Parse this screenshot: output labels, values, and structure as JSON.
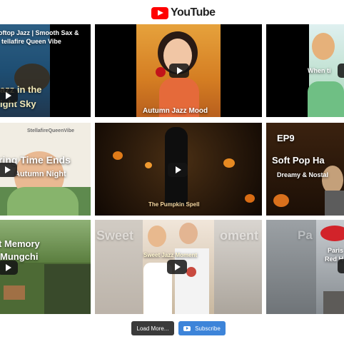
{
  "brand": {
    "logo_text": "YouTube"
  },
  "videos": [
    {
      "line1": "oftop Jazz | Smooth Sax &",
      "line2": "tellafire Queen Vibe",
      "line3": "azz in the",
      "line4": "ight Sky"
    },
    {
      "title": "Autumn Jazz Mood"
    },
    {
      "title": "When ti"
    },
    {
      "watermark": "StellafireQueenVibe",
      "line1": "ring Time Ends",
      "line2": "Autumn Night"
    },
    {
      "title": "The Pumpkin Spell"
    },
    {
      "line1": "EP9",
      "line2": "Soft Pop Ha",
      "line3": "Dreamy & Nostal"
    },
    {
      "line1": "t Memory",
      "line2": "Mungchi"
    },
    {
      "title": "Sweet  Jazz Moment",
      "ghost_left": "Sweet",
      "ghost_right": "oment"
    },
    {
      "line1": "Paris",
      "line2": "Red H",
      "ghost": "Pa"
    }
  ],
  "footer": {
    "load_more_label": "Load More...",
    "subscribe_label": "Subscribe"
  },
  "colors": {
    "youtube_red": "#ff0000",
    "subscribe_blue": "#3d84d9",
    "load_more_gray": "#3a3a3a"
  }
}
